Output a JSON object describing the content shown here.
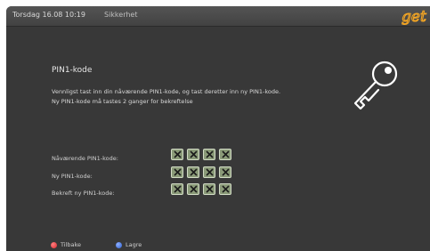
{
  "header": {
    "datetime": "Torsdag 16.08 10:19",
    "section": "Sikkerhet",
    "logo_icon": "get-logo-icon",
    "logo_color": "#f5a623"
  },
  "dialog": {
    "title": "PIN1-kode",
    "description": "Vennligst tast inn din nåværende PIN1-kode, og tast deretter inn ny PIN1-kode. Ny PIN1-kode må tastes 2 ganger for bekreftelse",
    "icon": "key-icon",
    "rows": [
      {
        "label": "Nåværende PIN1-kode:"
      },
      {
        "label": "Ny PIN1-kode:"
      },
      {
        "label": "Bekreft ny PIN1-kode:"
      }
    ],
    "pin_box_icon": "x-icon"
  },
  "footer": {
    "back": {
      "label": "Tilbake",
      "color": "#d9272e"
    },
    "save": {
      "label": "Lagre",
      "color": "#2d5fd0"
    }
  }
}
